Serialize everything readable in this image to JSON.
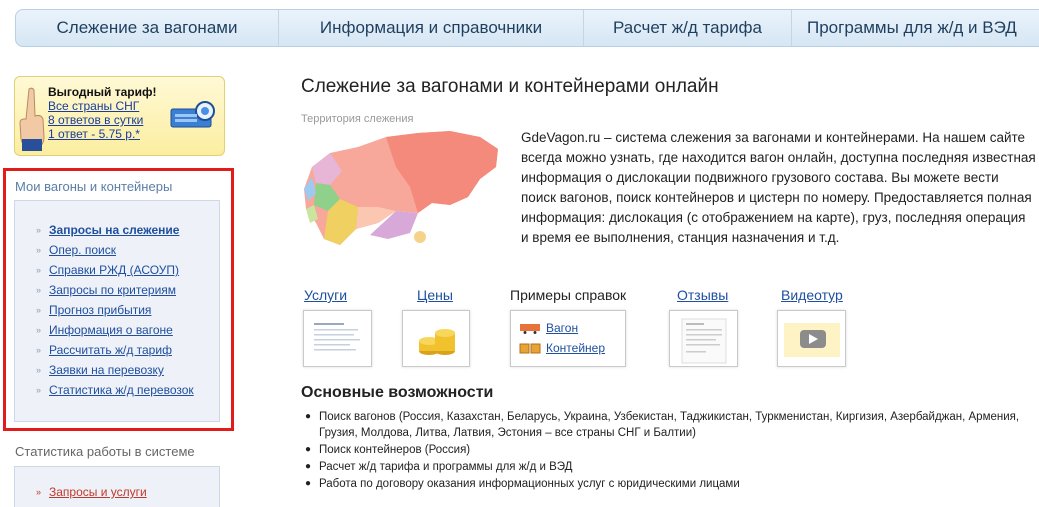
{
  "nav": {
    "items": [
      {
        "label": "Слежение за вагонами"
      },
      {
        "label": "Информация и справочники"
      },
      {
        "label": "Расчет ж/д тарифа"
      },
      {
        "label": "Программы для ж/д и ВЭД"
      }
    ]
  },
  "promo": {
    "title": "Выгодный тариф!",
    "lines": [
      "Все страны СНГ",
      "8 ответов в сутки",
      "1 ответ - 5.75 р.*"
    ]
  },
  "sidebar": {
    "section_title": "Мои вагоны и контейнеры",
    "items": [
      {
        "label": "Запросы на слежение"
      },
      {
        "label": "Опер. поиск"
      },
      {
        "label": "Справки РЖД (АСОУП)"
      },
      {
        "label": "Запросы по критериям"
      },
      {
        "label": "Прогноз прибытия"
      },
      {
        "label": "Информация о вагоне"
      },
      {
        "label": "Рассчитать ж/д тариф"
      },
      {
        "label": "Заявки на перевозку"
      },
      {
        "label": "Статистика ж/д перевозок"
      }
    ],
    "stats_title": "Статистика работы в системе",
    "stats_items": [
      {
        "label": "Запросы и услуги"
      }
    ]
  },
  "main": {
    "title": "Слежение за вагонами и контейнерами онлайн",
    "map_label": "Территория слежения",
    "description": "GdeVagon.ru – система слежения за вагонами и контейнерами. На нашем сайте всегда можно узнать, где находится вагон онлайн, доступна последняя известная информация о дислокации подвижного грузового состава. Вы можете вести поиск вагонов, поиск контейнеров и цистерн по номеру. Предоставляется полная информация: дислокация (с отображением на карте), груз, последняя операция и время ее выполнения, станция назначения и т.д.",
    "tiles": {
      "services": "Услуги",
      "prices": "Цены",
      "examples": "Примеры справок",
      "example_wagon": "Вагон",
      "example_container": "Контейнер",
      "reviews": "Отзывы",
      "video": "Видеотур"
    },
    "features_title": "Основные возможности",
    "features": [
      "Поиск вагонов (Россия, Казахстан, Беларусь, Украина, Узбекистан, Таджикистан, Туркменистан, Киргизия, Азербайджан, Армения, Грузия, Молдова, Литва, Латвия, Эстония – все страны СНГ и Балтии)",
      "Поиск контейнеров (Россия)",
      "Расчет ж/д тарифа и программы для ж/д и ВЭД",
      "Работа по договору оказания информационных услуг с юридическими лицами"
    ]
  },
  "colors": {
    "nav_text": "#1f3f5f",
    "link": "#1f4fa0",
    "highlight_border": "#e21b1b",
    "section_title": "#5b7ea6"
  }
}
